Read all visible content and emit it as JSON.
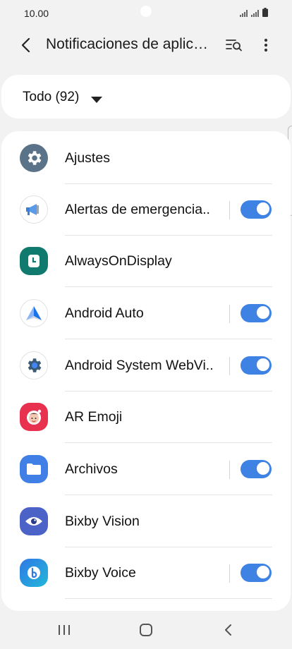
{
  "status_bar": {
    "time": "10.00"
  },
  "header": {
    "title": "Notificaciones de aplicaciones"
  },
  "filter": {
    "label": "Todo (92)"
  },
  "apps": [
    {
      "name": "Ajustes",
      "icon": "settings-icon",
      "toggle": null
    },
    {
      "name": "Alertas de emergencia..",
      "icon": "megaphone-icon",
      "toggle": true
    },
    {
      "name": "AlwaysOnDisplay",
      "icon": "clock-icon",
      "toggle": null
    },
    {
      "name": "Android Auto",
      "icon": "android-auto-icon",
      "toggle": true
    },
    {
      "name": "Android System WebVi..",
      "icon": "webview-icon",
      "toggle": true
    },
    {
      "name": "AR Emoji",
      "icon": "ar-emoji-icon",
      "toggle": null
    },
    {
      "name": "Archivos",
      "icon": "folder-icon",
      "toggle": true
    },
    {
      "name": "Bixby Vision",
      "icon": "eye-icon",
      "toggle": null
    },
    {
      "name": "Bixby Voice",
      "icon": "bixby-icon",
      "toggle": true
    }
  ],
  "colors": {
    "accent": "#3e82e4",
    "background": "#f2f2f2",
    "card": "#ffffff"
  }
}
